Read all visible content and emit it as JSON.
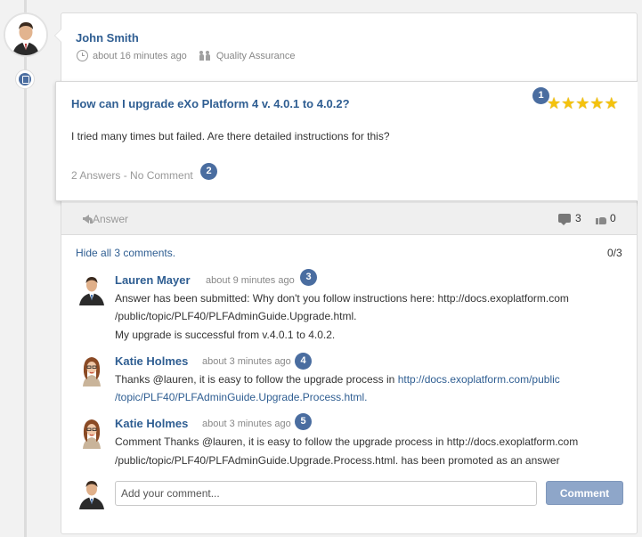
{
  "post": {
    "author": "John Smith",
    "time": "about 16 minutes ago",
    "space": "Quality Assurance"
  },
  "question": {
    "title": "How can I upgrade eXo Platform 4 v. 4.0.1 to 4.0.2?",
    "body": "I tried many times but failed. Are there detailed instructions for this?",
    "stats": "2 Answers - No Comment",
    "rating": 5
  },
  "actions": {
    "answer": "Answer",
    "comments": "3",
    "likes": "0"
  },
  "comments_section": {
    "hide_label": "Hide all 3 comments.",
    "ratio": "0/3"
  },
  "comments": [
    {
      "name": "Lauren Mayer",
      "time": "about 9 minutes ago",
      "line1": "Answer has been submitted: Why don't you follow instructions here: http://docs.exoplatform.com",
      "line2": "/public/topic/PLF40/PLFAdminGuide.Upgrade.html.",
      "line3": "My upgrade is successful from v.4.0.1 to 4.0.2."
    },
    {
      "name": "Katie Holmes",
      "time": "about 3 minutes ago",
      "line1_prefix": "Thanks @lauren, it is easy to follow the upgrade process in ",
      "line1_link": "http://docs.exoplatform.com/public",
      "line2_link": "/topic/PLF40/PLFAdminGuide.Upgrade.Process.html."
    },
    {
      "name": "Katie Holmes",
      "time": "about 3 minutes ago",
      "line1": "Comment Thanks @lauren, it is easy to follow the upgrade process in http://docs.exoplatform.com",
      "line2": "/public/topic/PLF40/PLFAdminGuide.Upgrade.Process.html. has been promoted as an answer"
    }
  ],
  "composer": {
    "placeholder": "Add your comment...",
    "button": "Comment"
  },
  "markers": [
    "1",
    "2",
    "3",
    "4",
    "5"
  ],
  "colors": {
    "link": "#2f5e92",
    "marker": "#4a6da0",
    "button": "#8ea6c9",
    "star": "#f4c20d"
  }
}
